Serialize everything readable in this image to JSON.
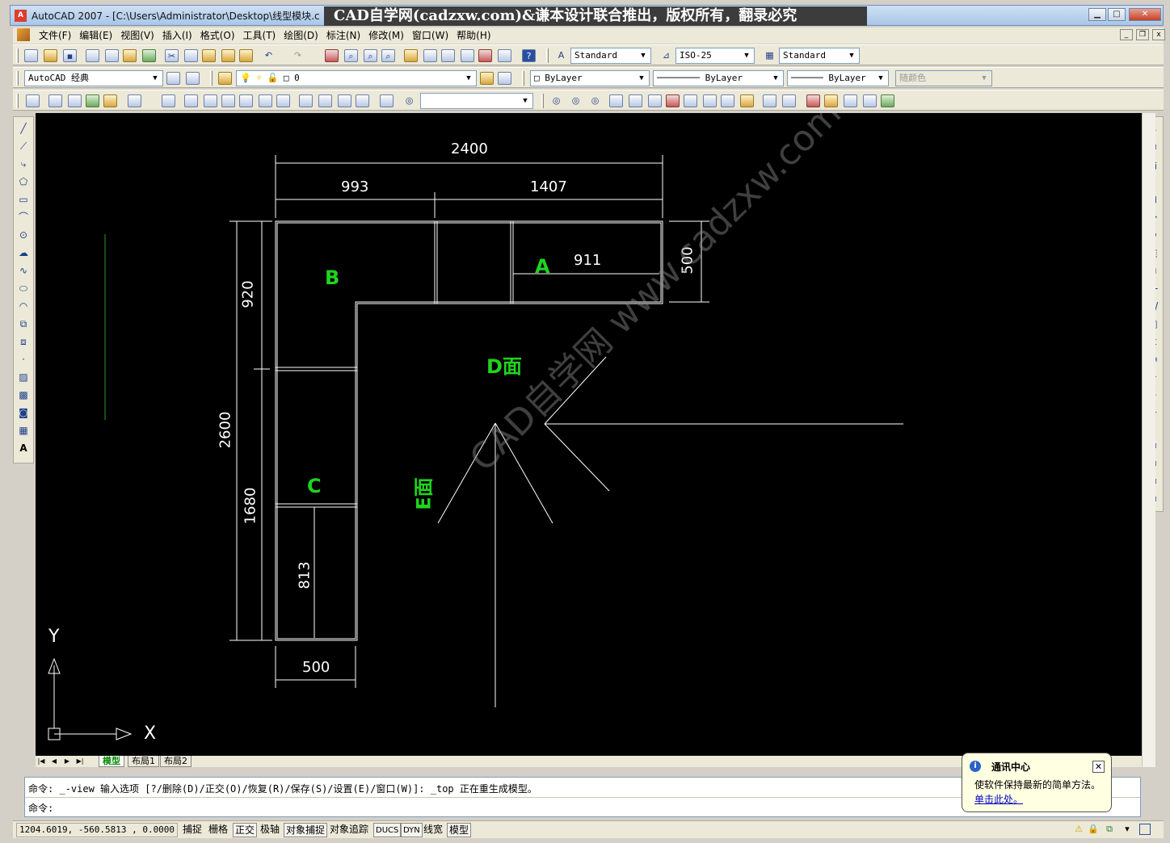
{
  "window": {
    "title": "AutoCAD 2007 - [C:\\Users\\Administrator\\Desktop\\线型模块.c",
    "watermark_banner": "CAD自学网(cadzxw.com)&谦本设计联合推出，版权所有，翻录必究",
    "app_icon": "A"
  },
  "menu": {
    "items": [
      "文件(F)",
      "编辑(E)",
      "视图(V)",
      "插入(I)",
      "格式(O)",
      "工具(T)",
      "绘图(D)",
      "标注(N)",
      "修改(M)",
      "窗口(W)",
      "帮助(H)"
    ]
  },
  "toolbar_styles": {
    "text_style": "Standard",
    "dim_style": "ISO-25",
    "table_style": "Standard"
  },
  "toolbar_layers": {
    "workspace": "AutoCAD 经典",
    "layer": "0",
    "color": "ByLayer",
    "linetype": "ByLayer",
    "lineweight": "ByLayer",
    "plot_style": "随颜色"
  },
  "drawing": {
    "dimensions": {
      "overall_width": "2400",
      "width_b": "993",
      "width_a": "1407",
      "depth_a": "500",
      "inner_a": "911",
      "overall_height": "2600",
      "height_b": "920",
      "height_c": "1680",
      "inner_c": "813",
      "depth_c": "500"
    },
    "labels": {
      "a": "A",
      "b": "B",
      "c": "C",
      "d_face": "D面",
      "e_face": "E面"
    },
    "watermark": "CAD自学网 www.cadzxw.com",
    "ucs_x": "X",
    "ucs_y": "Y",
    "label_color": "#1fd41f",
    "line_color": "#ffffff"
  },
  "layout_tabs": [
    "模型",
    "布局1",
    "布局2"
  ],
  "command": {
    "history": "命令: _-view 输入选项 [?/删除(D)/正交(O)/恢复(R)/保存(S)/设置(E)/窗口(W)]: _top 正在重生成模型。",
    "prompt": "命令:"
  },
  "status": {
    "coords": "1204.6019, -560.5813 , 0.0000",
    "buttons": [
      "捕捉",
      "栅格",
      "正交",
      "极轴",
      "对象捕捉",
      "对象追踪",
      "DUCS",
      "DYN",
      "线宽",
      "模型"
    ]
  },
  "balloon": {
    "title": "通讯中心",
    "message": "使软件保持最新的简单方法。",
    "link": "单击此处。"
  }
}
